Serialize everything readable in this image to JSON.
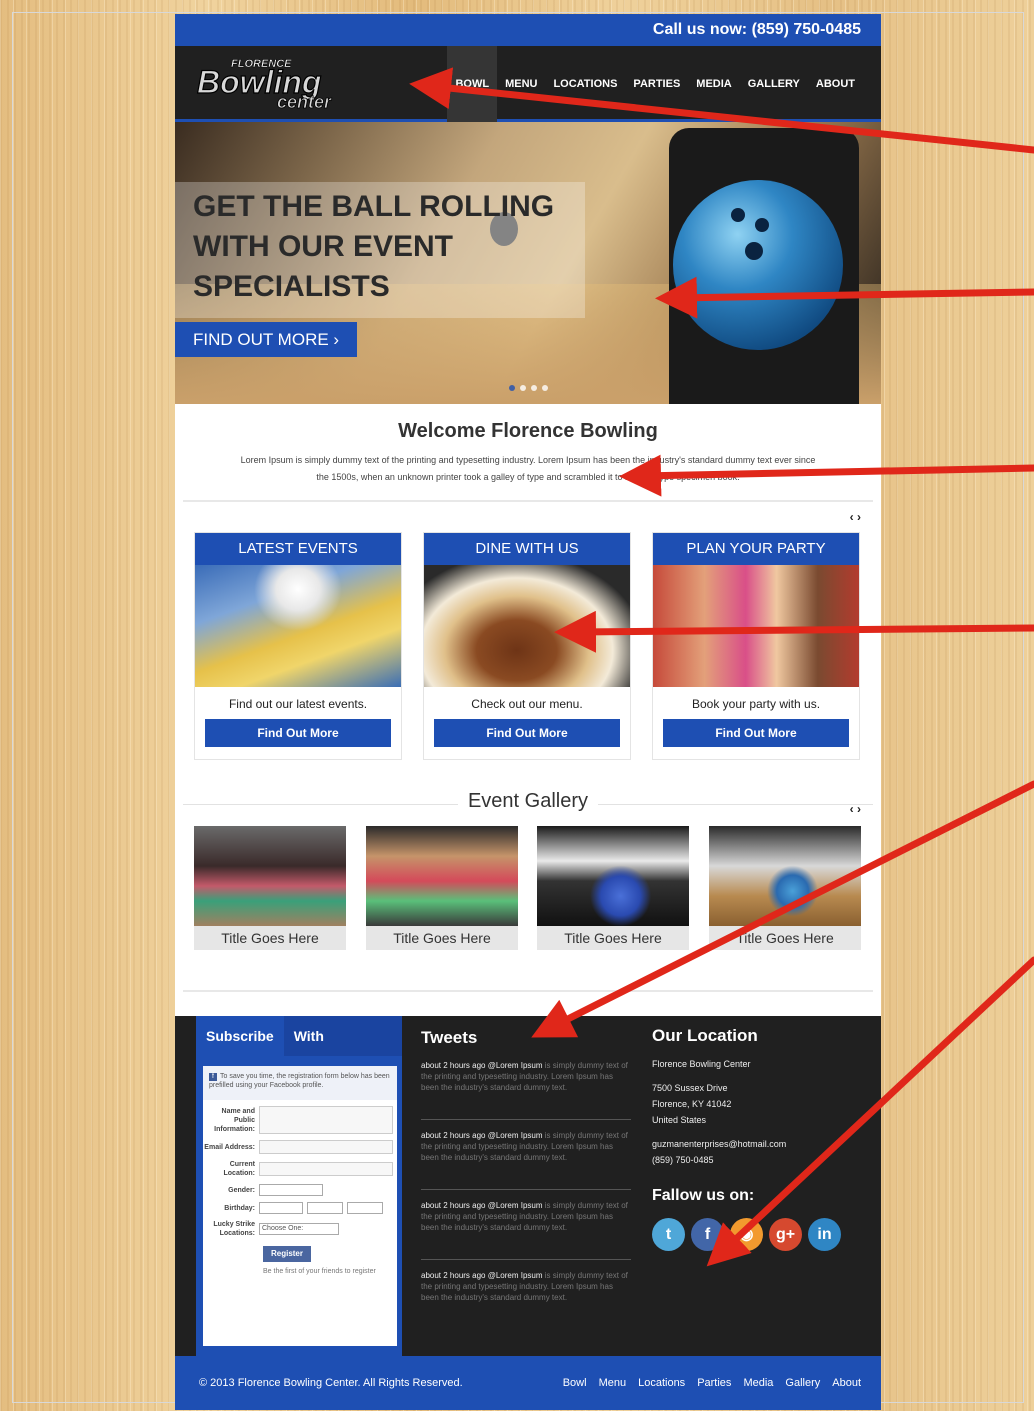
{
  "topbar": {
    "phone": "Call us now: (859) 750-0485"
  },
  "logo": {
    "top": "FLORENCE",
    "main": "Bowling",
    "sub": "center"
  },
  "nav": {
    "items": [
      "BOWL",
      "MENU",
      "LOCATIONS",
      "PARTIES",
      "MEDIA",
      "GALLERY",
      "ABOUT"
    ]
  },
  "hero": {
    "headline": "GET THE BALL ROLLING\nWITH OUR EVENT\nSPECIALISTS",
    "cta": "FIND OUT MORE  ›"
  },
  "welcome": {
    "title": "Welcome Florence Bowling",
    "text": "Lorem Ipsum is simply dummy text of the printing and typesetting industry. Lorem Ipsum has been the industry's standard dummy text ever since the 1500s, when an unknown printer took a galley of type and scrambled it to make a type specimen book."
  },
  "arrows": "‹ ›",
  "cards": [
    {
      "title": "LATEST EVENTS",
      "desc": "Find out our latest events.",
      "button": "Find Out More"
    },
    {
      "title": "DINE WITH US",
      "desc": "Check out our menu.",
      "button": "Find Out More"
    },
    {
      "title": "PLAN YOUR PARTY",
      "desc": "Book your party with us.",
      "button": "Find Out More"
    }
  ],
  "gallery": {
    "title": "Event Gallery",
    "items": [
      "Title Goes Here",
      "Title Goes Here",
      "Title Goes Here",
      "Title Goes Here"
    ]
  },
  "subscribe": {
    "tab1": "Subscribe",
    "tab2": "With Facebook ›",
    "note": "To save you time, the registration form below has been prefilled using your Facebook profile.",
    "fields": [
      "Name and Public Information:",
      "Email Address:",
      "Current Location:",
      "Gender:",
      "Birthday:",
      "Lucky Strike Locations:"
    ],
    "choose": "Choose One:",
    "register": "Register",
    "fine": "Be the first of your friends to register"
  },
  "tweets": {
    "title": "Tweets",
    "items": [
      {
        "meta": "about 2 hours ago @Lorem Ipsum",
        "text": " is simply dummy text of the printing and typesetting industry. Lorem Ipsum has been the industry's standard dummy text."
      },
      {
        "meta": "about 2 hours ago @Lorem Ipsum",
        "text": " is simply dummy text of the printing and typesetting industry. Lorem Ipsum has been the industry's standard dummy text."
      },
      {
        "meta": "about 2 hours ago @Lorem Ipsum",
        "text": " is simply dummy text of the printing and typesetting industry. Lorem Ipsum has been the industry's standard dummy text."
      },
      {
        "meta": "about 2 hours ago @Lorem Ipsum",
        "text": " is simply dummy text of the printing and typesetting industry. Lorem Ipsum has been the industry's standard dummy text."
      }
    ]
  },
  "location": {
    "title": "Our Location",
    "name": "Florence Bowling Center",
    "street": "7500 Sussex Drive",
    "city": "Florence, KY 41042",
    "country": "United States",
    "email": "guzmanenterprises@hotmail.com",
    "phone": "(859) 750-0485",
    "follow": "Fallow us on:"
  },
  "social": [
    {
      "icon": "twitter-icon",
      "glyph": "t",
      "color": "#4fa7d8"
    },
    {
      "icon": "facebook-icon",
      "glyph": "f",
      "color": "#4266a8"
    },
    {
      "icon": "rss-icon",
      "glyph": "◉",
      "color": "#f29a2e"
    },
    {
      "icon": "googleplus-icon",
      "glyph": "g+",
      "color": "#d6492f"
    },
    {
      "icon": "linkedin-icon",
      "glyph": "in",
      "color": "#2f86c4"
    }
  ],
  "footer": {
    "copyright": "© 2013 Florence Bowling Center. All Rights Reserved.",
    "links": [
      "Bowl",
      "Menu",
      "Locations",
      "Parties",
      "Media",
      "Gallery",
      "About"
    ]
  },
  "colors": {
    "brand_blue": "#1e4fb3",
    "dark": "#202020",
    "annotation_red": "#e0271a"
  }
}
